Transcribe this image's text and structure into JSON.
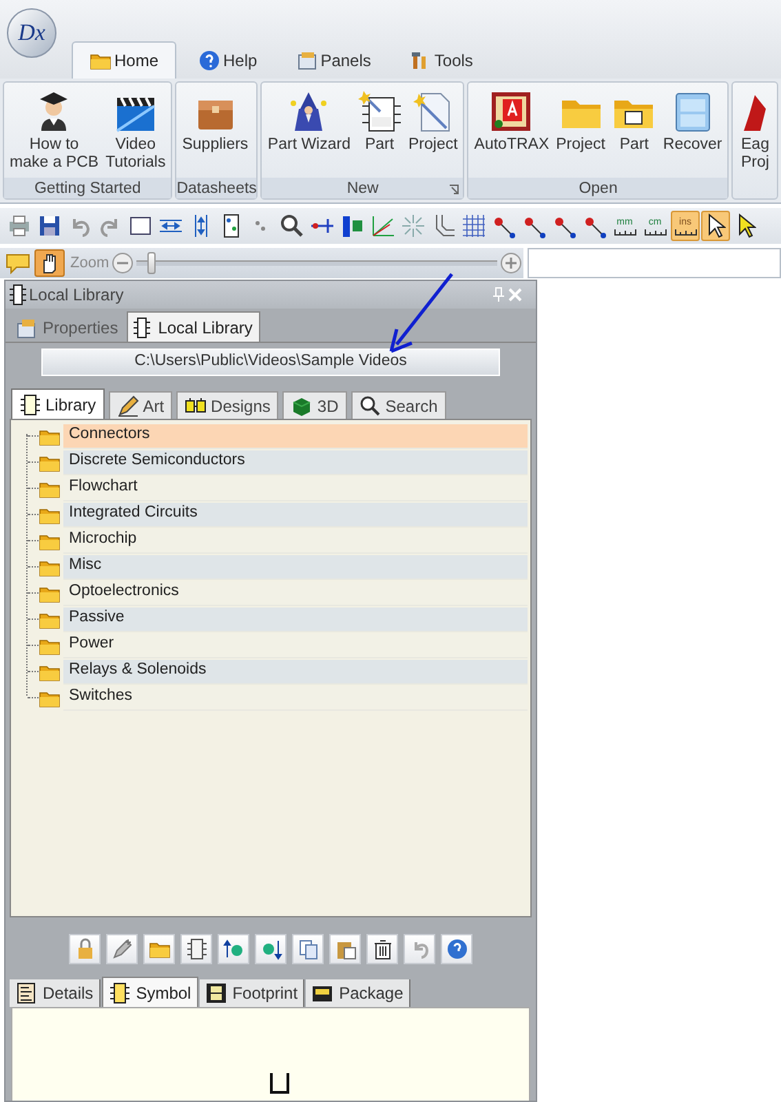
{
  "app": {
    "logo": "Dx"
  },
  "ribbon_tabs": [
    {
      "label": "Home",
      "selected": true
    },
    {
      "label": "Help",
      "selected": false
    },
    {
      "label": "Panels",
      "selected": false
    },
    {
      "label": "Tools",
      "selected": false
    }
  ],
  "ribbon_groups": [
    {
      "title": "Getting Started",
      "launcher": false,
      "items": [
        {
          "label": "How to\nmake a PCB"
        },
        {
          "label": "Video\nTutorials"
        }
      ]
    },
    {
      "title": "Datasheets",
      "launcher": false,
      "items": [
        {
          "label": "Suppliers"
        }
      ]
    },
    {
      "title": "New",
      "launcher": true,
      "items": [
        {
          "label": "Part Wizard"
        },
        {
          "label": "Part"
        },
        {
          "label": "Project"
        }
      ]
    },
    {
      "title": "Open",
      "launcher": false,
      "items": [
        {
          "label": "AutoTRAX"
        },
        {
          "label": "Project"
        },
        {
          "label": "Part"
        },
        {
          "label": "Recover"
        }
      ]
    },
    {
      "items": [
        {
          "label": "Eag\nProj"
        }
      ]
    }
  ],
  "toolbar": {
    "unit_buttons": [
      {
        "label": "mm",
        "selected": false
      },
      {
        "label": "cm",
        "selected": false
      },
      {
        "label": "ins",
        "selected": true
      }
    ],
    "select_tool": {
      "selected": true
    }
  },
  "zoom_bar": {
    "hand_tool": {
      "selected": true
    },
    "label": "Zoom",
    "level": 0.03
  },
  "panel": {
    "title": "Local Library",
    "tabs": [
      {
        "label": "Properties",
        "selected": false
      },
      {
        "label": "Local Library",
        "selected": true
      }
    ],
    "path": "C:\\Users\\Public\\Videos\\Sample Videos",
    "library_tabs": [
      {
        "label": "Library",
        "selected": true
      },
      {
        "label": "Art",
        "selected": false
      },
      {
        "label": "Designs",
        "selected": false
      },
      {
        "label": "3D",
        "selected": false
      },
      {
        "label": "Search",
        "selected": false
      }
    ],
    "tree": [
      {
        "label": "Connectors",
        "selected": true
      },
      {
        "label": "Discrete Semiconductors",
        "selected": false
      },
      {
        "label": "Flowchart",
        "selected": false
      },
      {
        "label": "Integrated Circuits",
        "selected": false
      },
      {
        "label": "Microchip",
        "selected": false
      },
      {
        "label": "Misc",
        "selected": false
      },
      {
        "label": "Optoelectronics",
        "selected": false
      },
      {
        "label": "Passive",
        "selected": false
      },
      {
        "label": "Power",
        "selected": false
      },
      {
        "label": "Relays & Solenoids",
        "selected": false
      },
      {
        "label": "Switches",
        "selected": false
      }
    ],
    "detail_tabs": [
      {
        "label": "Details",
        "selected": false
      },
      {
        "label": "Symbol",
        "selected": true
      },
      {
        "label": "Footprint",
        "selected": false
      },
      {
        "label": "Package",
        "selected": false
      }
    ]
  }
}
